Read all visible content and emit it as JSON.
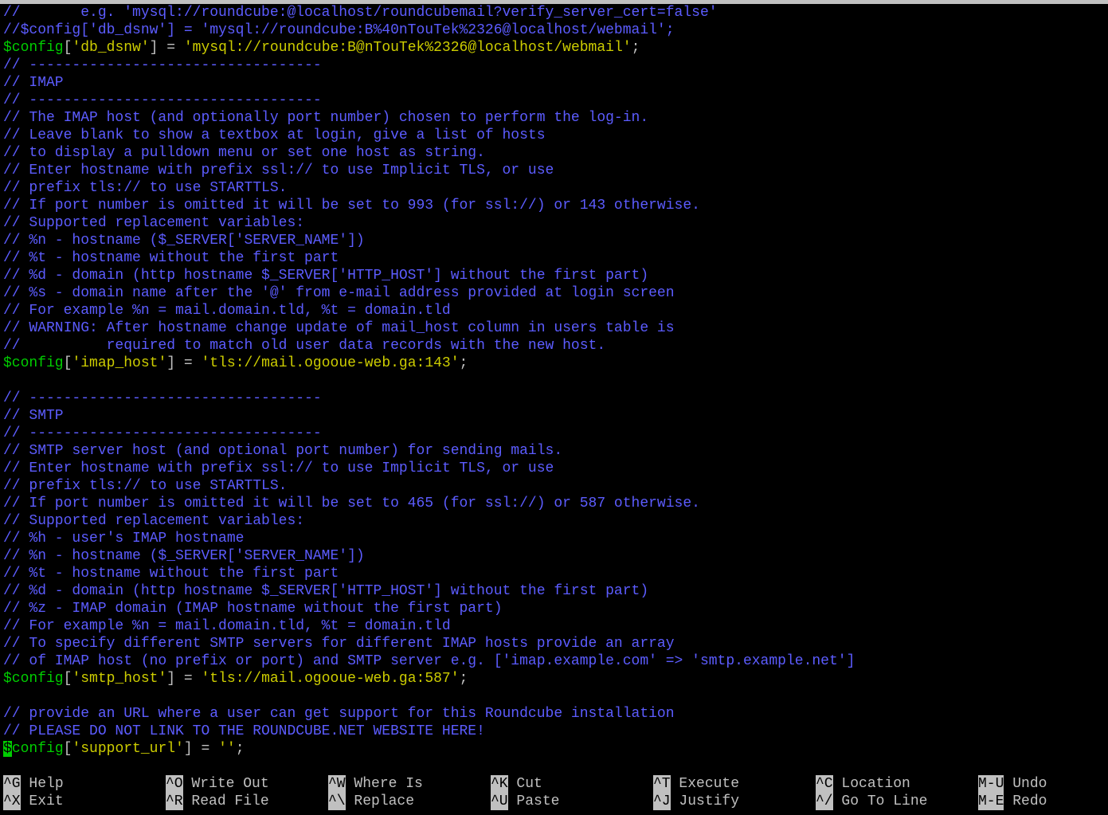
{
  "editor": {
    "lines": [
      [
        {
          "t": "c",
          "x": "//       e.g. 'mysql://roundcube:@localhost/roundcubemail?verify_server_cert=false'"
        }
      ],
      [
        {
          "t": "c",
          "x": "//$config['db_dsnw'] = 'mysql://roundcube:B%40nTouTek%2326@localhost/webmail';"
        }
      ],
      [
        {
          "t": "v",
          "x": "$config"
        },
        {
          "t": "t",
          "x": "["
        },
        {
          "t": "s",
          "x": "'db_dsnw'"
        },
        {
          "t": "t",
          "x": "] = "
        },
        {
          "t": "s",
          "x": "'mysql://roundcube:B@nTouTek%2326@localhost/webmail'"
        },
        {
          "t": "t",
          "x": ";"
        }
      ],
      [
        {
          "t": "c",
          "x": "// ----------------------------------"
        }
      ],
      [
        {
          "t": "c",
          "x": "// IMAP"
        }
      ],
      [
        {
          "t": "c",
          "x": "// ----------------------------------"
        }
      ],
      [
        {
          "t": "c",
          "x": "// The IMAP host (and optionally port number) chosen to perform the log-in."
        }
      ],
      [
        {
          "t": "c",
          "x": "// Leave blank to show a textbox at login, give a list of hosts"
        }
      ],
      [
        {
          "t": "c",
          "x": "// to display a pulldown menu or set one host as string."
        }
      ],
      [
        {
          "t": "c",
          "x": "// Enter hostname with prefix ssl:// to use Implicit TLS, or use"
        }
      ],
      [
        {
          "t": "c",
          "x": "// prefix tls:// to use STARTTLS."
        }
      ],
      [
        {
          "t": "c",
          "x": "// If port number is omitted it will be set to 993 (for ssl://) or 143 otherwise."
        }
      ],
      [
        {
          "t": "c",
          "x": "// Supported replacement variables:"
        }
      ],
      [
        {
          "t": "c",
          "x": "// %n - hostname ($_SERVER['SERVER_NAME'])"
        }
      ],
      [
        {
          "t": "c",
          "x": "// %t - hostname without the first part"
        }
      ],
      [
        {
          "t": "c",
          "x": "// %d - domain (http hostname $_SERVER['HTTP_HOST'] without the first part)"
        }
      ],
      [
        {
          "t": "c",
          "x": "// %s - domain name after the '@' from e-mail address provided at login screen"
        }
      ],
      [
        {
          "t": "c",
          "x": "// For example %n = mail.domain.tld, %t = domain.tld"
        }
      ],
      [
        {
          "t": "c",
          "x": "// WARNING: After hostname change update of mail_host column in users table is"
        }
      ],
      [
        {
          "t": "c",
          "x": "//          required to match old user data records with the new host."
        }
      ],
      [
        {
          "t": "v",
          "x": "$config"
        },
        {
          "t": "t",
          "x": "["
        },
        {
          "t": "s",
          "x": "'imap_host'"
        },
        {
          "t": "t",
          "x": "] = "
        },
        {
          "t": "s",
          "x": "'tls://mail.ogooue-web.ga:143'"
        },
        {
          "t": "t",
          "x": ";"
        }
      ],
      [
        {
          "t": "t",
          "x": ""
        }
      ],
      [
        {
          "t": "c",
          "x": "// ----------------------------------"
        }
      ],
      [
        {
          "t": "c",
          "x": "// SMTP"
        }
      ],
      [
        {
          "t": "c",
          "x": "// ----------------------------------"
        }
      ],
      [
        {
          "t": "c",
          "x": "// SMTP server host (and optional port number) for sending mails."
        }
      ],
      [
        {
          "t": "c",
          "x": "// Enter hostname with prefix ssl:// to use Implicit TLS, or use"
        }
      ],
      [
        {
          "t": "c",
          "x": "// prefix tls:// to use STARTTLS."
        }
      ],
      [
        {
          "t": "c",
          "x": "// If port number is omitted it will be set to 465 (for ssl://) or 587 otherwise."
        }
      ],
      [
        {
          "t": "c",
          "x": "// Supported replacement variables:"
        }
      ],
      [
        {
          "t": "c",
          "x": "// %h - user's IMAP hostname"
        }
      ],
      [
        {
          "t": "c",
          "x": "// %n - hostname ($_SERVER['SERVER_NAME'])"
        }
      ],
      [
        {
          "t": "c",
          "x": "// %t - hostname without the first part"
        }
      ],
      [
        {
          "t": "c",
          "x": "// %d - domain (http hostname $_SERVER['HTTP_HOST'] without the first part)"
        }
      ],
      [
        {
          "t": "c",
          "x": "// %z - IMAP domain (IMAP hostname without the first part)"
        }
      ],
      [
        {
          "t": "c",
          "x": "// For example %n = mail.domain.tld, %t = domain.tld"
        }
      ],
      [
        {
          "t": "c",
          "x": "// To specify different SMTP servers for different IMAP hosts provide an array"
        }
      ],
      [
        {
          "t": "c",
          "x": "// of IMAP host (no prefix or port) and SMTP server e.g. ['imap.example.com' => 'smtp.example.net']"
        }
      ],
      [
        {
          "t": "v",
          "x": "$config"
        },
        {
          "t": "t",
          "x": "["
        },
        {
          "t": "s",
          "x": "'smtp_host'"
        },
        {
          "t": "t",
          "x": "] = "
        },
        {
          "t": "s",
          "x": "'tls://mail.ogooue-web.ga:587'"
        },
        {
          "t": "t",
          "x": ";"
        }
      ],
      [
        {
          "t": "t",
          "x": ""
        }
      ],
      [
        {
          "t": "c",
          "x": "// provide an URL where a user can get support for this Roundcube installation"
        }
      ],
      [
        {
          "t": "c",
          "x": "// PLEASE DO NOT LINK TO THE ROUNDCUBE.NET WEBSITE HERE!"
        }
      ],
      [
        {
          "t": "cursor",
          "x": "$"
        },
        {
          "t": "v",
          "x": "config"
        },
        {
          "t": "t",
          "x": "["
        },
        {
          "t": "s",
          "x": "'support_url'"
        },
        {
          "t": "t",
          "x": "] = "
        },
        {
          "t": "s",
          "x": "''"
        },
        {
          "t": "t",
          "x": ";"
        }
      ]
    ]
  },
  "shortcuts": [
    {
      "key": "^G",
      "label": "Help"
    },
    {
      "key": "^O",
      "label": "Write Out"
    },
    {
      "key": "^W",
      "label": "Where Is"
    },
    {
      "key": "^K",
      "label": "Cut"
    },
    {
      "key": "^T",
      "label": "Execute"
    },
    {
      "key": "^C",
      "label": "Location"
    },
    {
      "key": "M-U",
      "label": "Undo"
    },
    {
      "key": "^X",
      "label": "Exit"
    },
    {
      "key": "^R",
      "label": "Read File"
    },
    {
      "key": "^\\",
      "label": "Replace"
    },
    {
      "key": "^U",
      "label": "Paste"
    },
    {
      "key": "^J",
      "label": "Justify"
    },
    {
      "key": "^/",
      "label": "Go To Line"
    },
    {
      "key": "M-E",
      "label": "Redo"
    }
  ],
  "colors": {
    "background": "#000000",
    "comment": "#5c5cff",
    "variable": "#00cd00",
    "string": "#cdcd00",
    "text": "#c0c0c0",
    "key_bg": "#c0c0c0"
  }
}
